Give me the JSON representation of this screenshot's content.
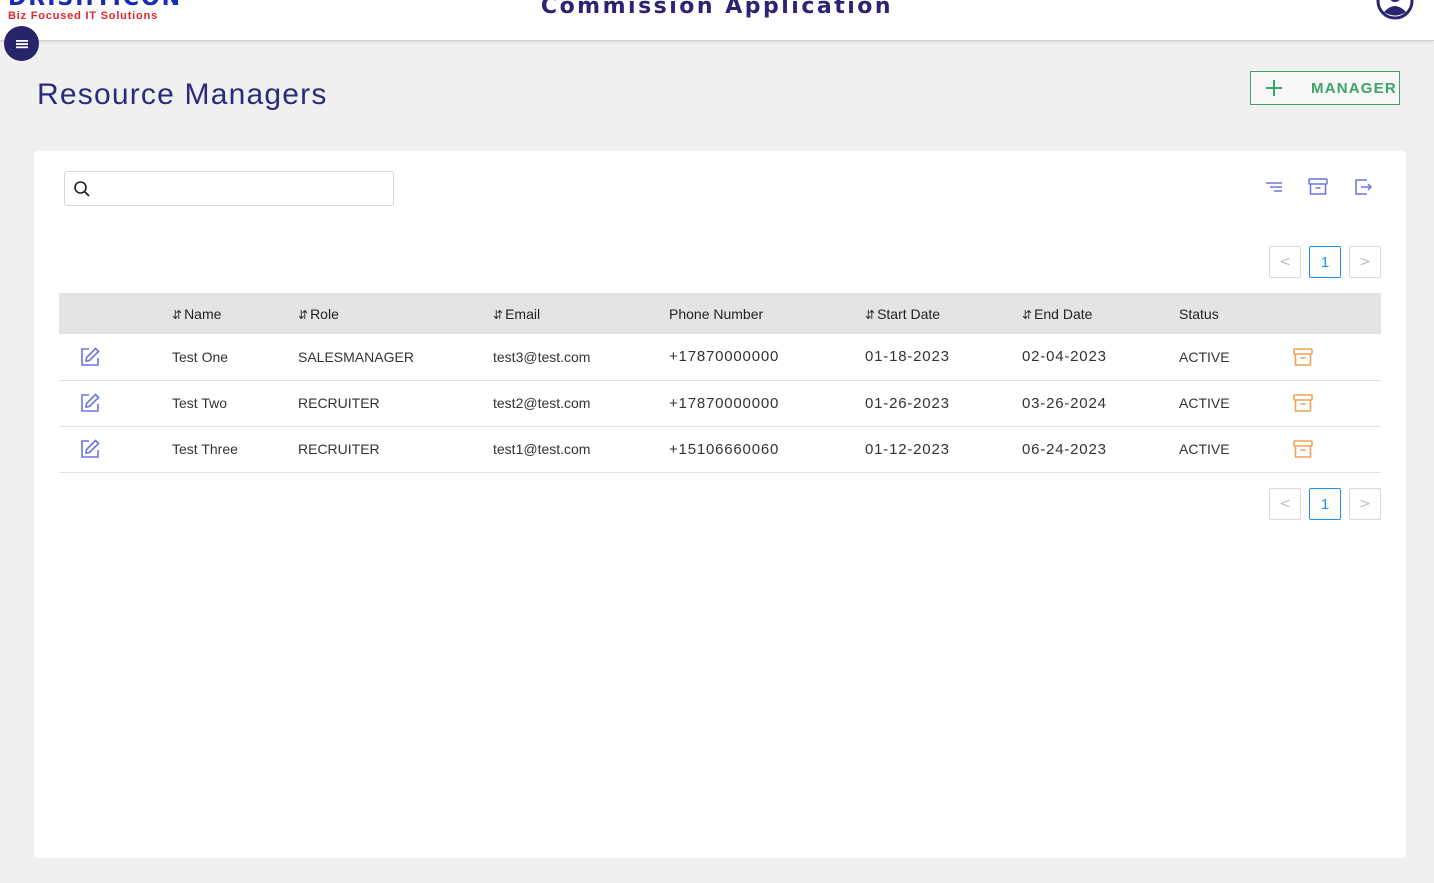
{
  "header": {
    "logo_main": "DRISHTICON",
    "logo_tagline": "Biz Focused IT Solutions",
    "app_title": "Commission Application"
  },
  "page": {
    "title": "Resource Managers",
    "add_button_label": "MANAGER"
  },
  "search": {
    "value": "",
    "placeholder": ""
  },
  "pagination": {
    "current_page": "1",
    "prev": "<",
    "next": ">"
  },
  "table": {
    "columns": [
      "",
      "Name",
      "Role",
      "Email",
      "Phone Number",
      "Start Date",
      "End Date",
      "Status",
      ""
    ],
    "sortable": [
      false,
      true,
      true,
      true,
      false,
      true,
      true,
      false,
      false
    ],
    "sort_glyph": "⇵",
    "rows": [
      {
        "name": "Test One",
        "role": "SALESMANAGER",
        "email": "test3@test.com",
        "phone": "+17870000000",
        "start_date": "01-18-2023",
        "end_date": "02-04-2023",
        "status": "ACTIVE"
      },
      {
        "name": "Test Two",
        "role": "RECRUITER",
        "email": "test2@test.com",
        "phone": "+17870000000",
        "start_date": "01-26-2023",
        "end_date": "03-26-2024",
        "status": "ACTIVE"
      },
      {
        "name": "Test Three",
        "role": "RECRUITER",
        "email": "test1@test.com",
        "phone": "+15106660060",
        "start_date": "01-12-2023",
        "end_date": "06-24-2023",
        "status": "ACTIVE"
      }
    ]
  },
  "icons": {
    "menu": "hamburger-icon",
    "avatar": "user-circle-icon",
    "add": "plus-icon",
    "search": "search-icon",
    "filter": "filter-icon",
    "archive": "archive-icon",
    "export": "export-icon",
    "edit": "edit-icon",
    "row_archive": "archive-icon"
  },
  "colors": {
    "brand_dark": "#2b2473",
    "logo_blue": "#1a2bb8",
    "logo_red": "#e3262b",
    "add_green": "#3aa565",
    "icon_blue": "#6b75e0",
    "archive_orange": "#f0a25a",
    "pager_active": "#1890ff"
  }
}
